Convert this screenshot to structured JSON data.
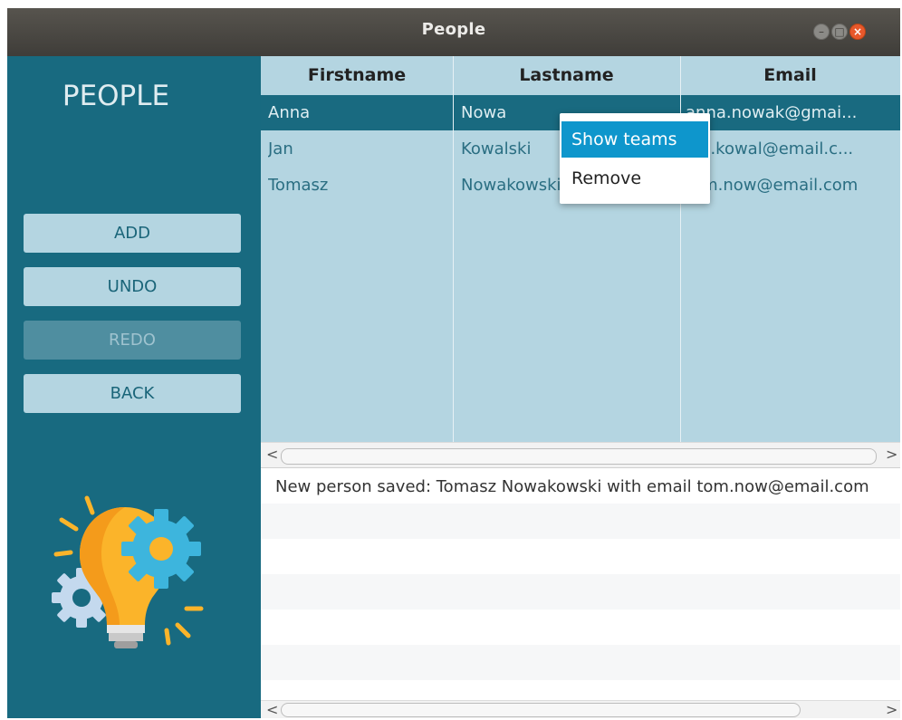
{
  "window": {
    "title": "People"
  },
  "sidebar": {
    "title": "PEOPLE",
    "buttons": {
      "add": "ADD",
      "undo": "UNDO",
      "redo": "REDO",
      "back": "BACK"
    }
  },
  "table": {
    "columns": [
      "Firstname",
      "Lastname",
      "Email"
    ],
    "rows": [
      {
        "firstname": "Anna",
        "lastname": "Nowa",
        "email": "anna.nowak@gmai..."
      },
      {
        "firstname": "Jan",
        "lastname": "Kowalski",
        "email": "jan.kowal@email.c..."
      },
      {
        "firstname": "Tomasz",
        "lastname": "Nowakowski",
        "email": "tom.now@email.com"
      }
    ],
    "selected_row": 0
  },
  "context_menu": {
    "items": [
      "Show teams",
      "Remove"
    ]
  },
  "log": {
    "lines": [
      "New person saved: Tomasz Nowakowski with email tom.now@email.com"
    ]
  },
  "colors": {
    "sidebar_bg": "#186a80",
    "button_bg": "#b4d5e1",
    "selection": "#196a80",
    "menu_highlight": "#0e96cc"
  },
  "icons": {
    "illustration": "lightbulb-gears-icon"
  }
}
